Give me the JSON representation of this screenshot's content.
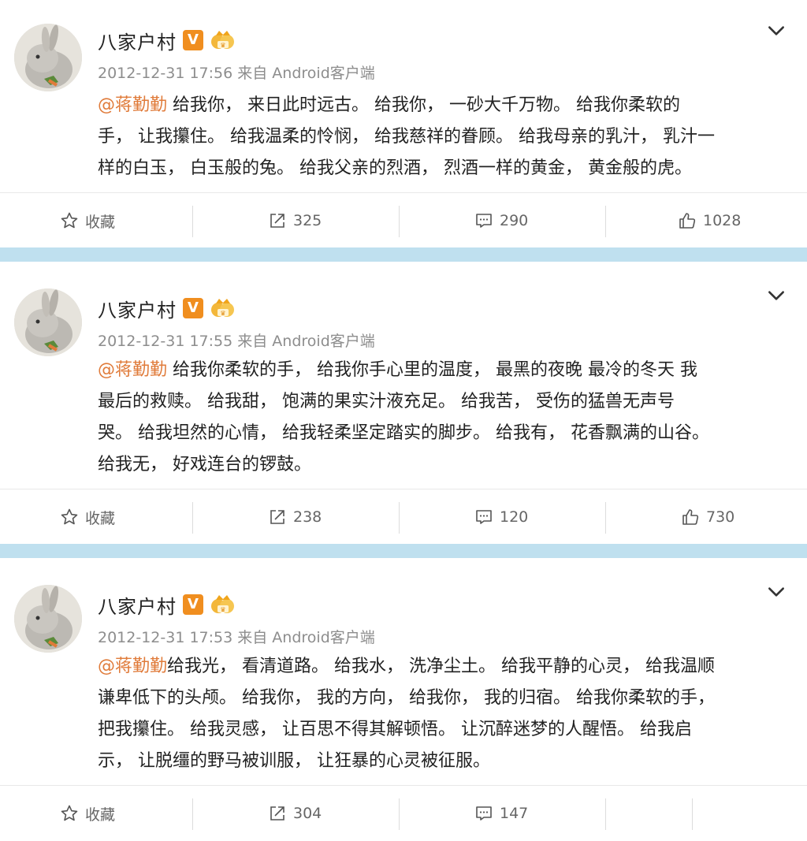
{
  "posts": [
    {
      "name": "八家户村",
      "badge_v": "V",
      "time_source": "2012-12-31 17:56 来自 Android客户端",
      "mention": "@蒋勤勤",
      "content_lines": [
        " 给我你， 来日此时远古。 给我你， 一砂大千万物。 给我你柔软的",
        "手， 让我攥住。 给我温柔的怜悯， 给我慈祥的眷顾。 给我母亲的乳汁， 乳汁一",
        "样的白玉， 白玉般的兔。 给我父亲的烈酒， 烈酒一样的黄金， 黄金般的虎。"
      ],
      "actions": {
        "favorite": "收藏",
        "repost": "325",
        "comment": "290",
        "like": "1028"
      }
    },
    {
      "name": "八家户村",
      "badge_v": "V",
      "time_source": "2012-12-31 17:55 来自 Android客户端",
      "mention": "@蒋勤勤",
      "content_lines": [
        " 给我你柔软的手， 给我你手心里的温度， 最黑的夜晚 最冷的冬天 我",
        "最后的救赎。 给我甜， 饱满的果实汁液充足。 给我苦， 受伤的猛兽无声号",
        "哭。 给我坦然的心情， 给我轻柔坚定踏实的脚步。 给我有， 花香飘满的山谷。",
        "给我无， 好戏连台的锣鼓。"
      ],
      "actions": {
        "favorite": "收藏",
        "repost": "238",
        "comment": "120",
        "like": "730"
      }
    },
    {
      "name": "八家户村",
      "badge_v": "V",
      "time_source": "2012-12-31 17:53 来自 Android客户端",
      "mention": "@蒋勤勤",
      "content_lines": [
        "给我光， 看清道路。 给我水， 洗净尘土。 给我平静的心灵， 给我温顺",
        "谦卑低下的头颅。 给我你， 我的方向， 给我你， 我的归宿。 给我你柔软的手，",
        "把我攥住。 给我灵感， 让百思不得其解顿悟。 让沉醉迷梦的人醒悟。 给我启",
        "示， 让脱缰的野马被训服， 让狂暴的心灵被征服。"
      ],
      "actions": {
        "favorite": "收藏",
        "repost": "304",
        "comment": "147"
      }
    }
  ],
  "icons": {
    "favorite": "star-outline-icon",
    "repost": "share-box-icon",
    "comment": "comment-bubble-icon",
    "like": "thumbs-up-icon",
    "more": "chevron-down-icon",
    "verified": "verified-v-icon",
    "vip": "crown-badge-icon"
  },
  "colors": {
    "mention": "#e07b3a",
    "separator": "#bfe0ef",
    "verified": "#f08e1f"
  }
}
